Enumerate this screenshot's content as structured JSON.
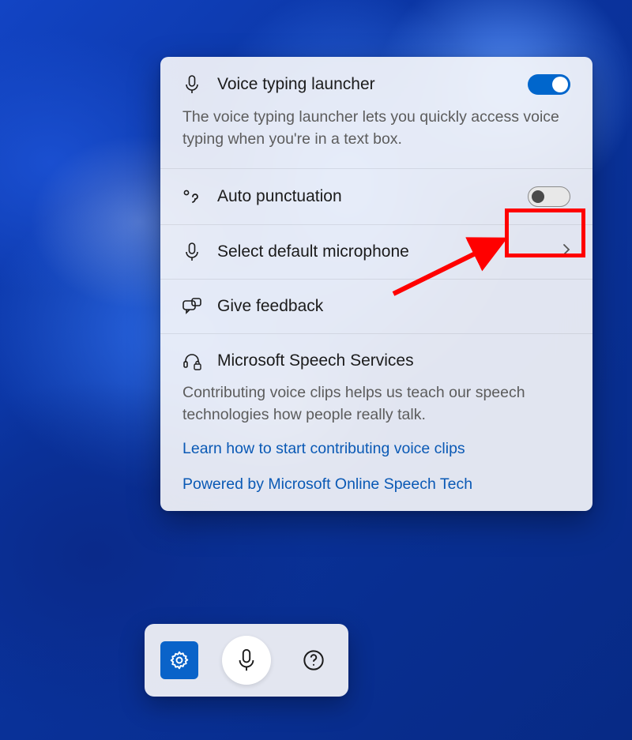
{
  "panel": {
    "launcher": {
      "title": "Voice typing launcher",
      "description": "The voice typing launcher lets you quickly access voice typing when you're in a text box.",
      "enabled": true
    },
    "auto_punctuation": {
      "title": "Auto punctuation",
      "enabled": false
    },
    "microphone": {
      "title": "Select default microphone"
    },
    "feedback": {
      "title": "Give feedback"
    },
    "speech_services": {
      "title": "Microsoft Speech Services",
      "description": "Contributing voice clips helps us teach our speech technologies how people really talk.",
      "link1": "Learn how to start contributing voice clips",
      "link2": "Powered by Microsoft Online Speech Tech"
    }
  },
  "toolbar": {
    "settings_label": "Settings",
    "mic_label": "Microphone",
    "help_label": "Help"
  },
  "annotation": {
    "highlight_color": "#ff0000"
  }
}
